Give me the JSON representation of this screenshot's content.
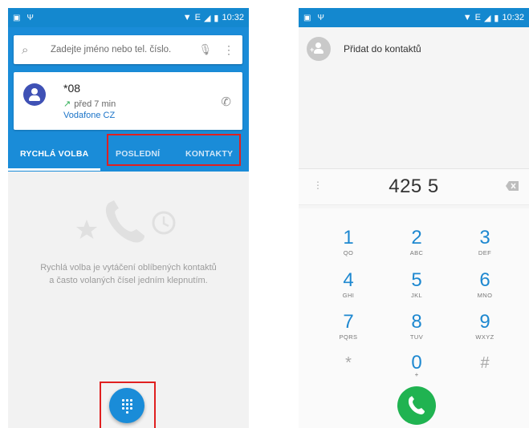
{
  "left": {
    "status": {
      "time": "10:32",
      "network": "E"
    },
    "search": {
      "placeholder": "Zadejte jméno nebo tel. číslo."
    },
    "recent_call": {
      "number": "*08",
      "time_ago": "před 7 min",
      "carrier": "Vodafone CZ"
    },
    "tabs": [
      {
        "label": "RYCHLÁ VOLBA",
        "active": true
      },
      {
        "label": "POSLEDNÍ",
        "active": false
      },
      {
        "label": "KONTAKTY",
        "active": false
      }
    ],
    "empty_message_line1": "Rychlá volba je vytáčení oblíbených kontaktů",
    "empty_message_line2": "a často volaných čísel jedním klepnutím.",
    "highlight_color": "#e02020"
  },
  "right": {
    "status": {
      "time": "10:32",
      "network": "E"
    },
    "add_contact_label": "Přidat do kontaktů",
    "dialed_number": "425 5",
    "keys": [
      {
        "digit": "1",
        "letters": "QO"
      },
      {
        "digit": "2",
        "letters": "ABC"
      },
      {
        "digit": "3",
        "letters": "DEF"
      },
      {
        "digit": "4",
        "letters": "GHI"
      },
      {
        "digit": "5",
        "letters": "JKL"
      },
      {
        "digit": "6",
        "letters": "MNO"
      },
      {
        "digit": "7",
        "letters": "PQRS"
      },
      {
        "digit": "8",
        "letters": "TUV"
      },
      {
        "digit": "9",
        "letters": "WXYZ"
      },
      {
        "digit": "*",
        "letters": ""
      },
      {
        "digit": "0",
        "letters": "+"
      },
      {
        "digit": "#",
        "letters": ""
      }
    ],
    "accent_color": "#1e88d0",
    "call_color": "#20b351"
  }
}
